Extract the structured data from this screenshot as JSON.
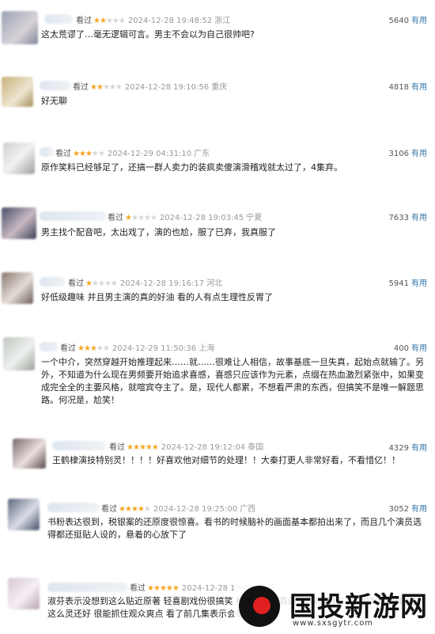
{
  "labels": {
    "seen": "看过",
    "useful": "有用"
  },
  "reviews": [
    {
      "stars": 2,
      "time": "2024-12-28 19:48:52",
      "location": "浙江",
      "votes": "5640",
      "text": "这太荒谬了…毫无逻辑可言。男主不会以为自己很帅吧?"
    },
    {
      "stars": 2,
      "time": "2024-12-28 19:10:56",
      "location": "重庆",
      "votes": "4818",
      "text": "好无聊"
    },
    {
      "stars": 3,
      "time": "2024-12-29 04:31:10",
      "location": "广东",
      "votes": "3106",
      "text": "原作笑料已经够足了，还搞一群人卖力的装疯卖傻演滑稽戏就太过了，4集弃。"
    },
    {
      "stars": 1,
      "time": "2024-12-28 19:03:45",
      "location": "宁夏",
      "votes": "7633",
      "text": "男主找个配音吧，太出戏了，演的也尬，服了已弃，我真服了"
    },
    {
      "stars": 1,
      "time": "2024-12-28 19:16:17",
      "location": "河北",
      "votes": "5941",
      "text": "好低级趣味 并且男主演的真的好油 看的人有点生理性反胃了"
    },
    {
      "stars": 3,
      "time": "2024-12-29 11:50:36",
      "location": "上海",
      "votes": "400",
      "text": "一个中介，突然穿越开始推理起来……就……很难让人相信，故事基底一旦失真，起始点就输了。另外，不知道为什么现在男频要开始追求喜感，喜感只应该作为元素，点缀在热血激烈紧张中，如果变成完全全的主要风格，就喧宾夺主了。是，现代人都累，不想看严肃的东西，但搞笑不是唯一解题思路。何况是，尬笑！"
    },
    {
      "stars": 5,
      "time": "2024-12-28 19:12:04",
      "location": "泰国",
      "votes": "4329",
      "text": "王鹤棣演技特别灵！！！！好喜欢他对细节的处理！！大秦打更人非常好看，不看惜亿！！"
    },
    {
      "stars": 4,
      "time": "2024-12-28 19:25:00",
      "location": "广西",
      "votes": "3052",
      "text": "书粉表达很到，税银案的还原度很惊喜。看书的时候脑补的画面基本都拍出来了，而且几个演员选得都还挺贴人设的，悬着的心放下了"
    },
    {
      "stars": 5,
      "time": "2024-12-28 19:07:07",
      "location": "江",
      "votes": "",
      "text": "淑芬表示没想到这么贴近原著 轻喜剧戏份很搞笑 梗也有滤镜真的有惊艳到我！ 没想到王鹤棣演技这么灵还好 很能抓住观众爽点 看了前几集表示会继续追的"
    }
  ],
  "watermark": {
    "title": "国投新游网",
    "url": "www.sxsgytr.com"
  }
}
